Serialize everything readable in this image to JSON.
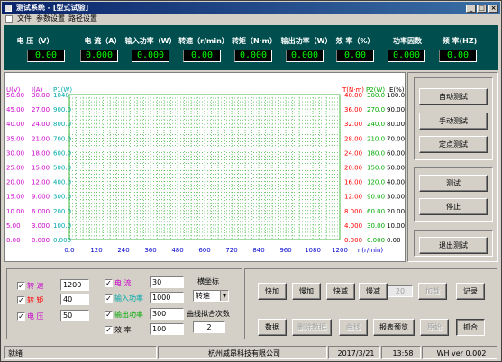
{
  "window": {
    "title": "测试系统 - [型式试验]"
  },
  "menu": {
    "items": [
      "文件",
      "参数设置",
      "路径设置"
    ]
  },
  "meters": [
    {
      "label": "电 压（V）",
      "value": "0.00"
    },
    {
      "label": "电 流（A）",
      "value": "0.000"
    },
    {
      "label": "输入功率（W）",
      "value": "0.000"
    },
    {
      "label": "转速（r/min）",
      "value": "0.00"
    },
    {
      "label": "转矩（N·m）",
      "value": "0.000"
    },
    {
      "label": "输出功率（W）",
      "value": "0.000"
    },
    {
      "label": "效 率（%）",
      "value": "0.00"
    },
    {
      "label": "功率因数",
      "value": "0.000"
    },
    {
      "label": "频 率(HZ)",
      "value": "0.00"
    }
  ],
  "chart": {
    "axis_headers": [
      "U(V)",
      "I(A)",
      "P1(W)",
      "T(N·m)",
      "P2(W)",
      "E(%)"
    ],
    "axis_colors": [
      "#cc00cc",
      "#cc00cc",
      "#00aaaa",
      "#ff0000",
      "#00aa00",
      "#000000"
    ],
    "left_u": [
      "50.00",
      "45.00",
      "40.00",
      "35.00",
      "30.00",
      "25.00",
      "20.00",
      "15.00",
      "10.00",
      "5.00",
      "0.00"
    ],
    "left_i": [
      "30.00",
      "27.00",
      "24.00",
      "21.00",
      "18.00",
      "15.00",
      "12.00",
      "9.000",
      "6.000",
      "3.000",
      "0.000"
    ],
    "left_p1": [
      "1040",
      "900.0",
      "800.0",
      "700.0",
      "600.0",
      "500.0",
      "400.0",
      "300.0",
      "200.0",
      "100.0",
      "0.000"
    ],
    "right_t": [
      "40.00",
      "36.00",
      "32.00",
      "28.00",
      "24.00",
      "20.00",
      "16.00",
      "12.00",
      "8.000",
      "4.000",
      "0.000"
    ],
    "right_p2": [
      "300.0",
      "270.0",
      "240.0",
      "210.0",
      "180.0",
      "150.0",
      "120.0",
      "90.00",
      "60.00",
      "30.00",
      "0.000"
    ],
    "right_e": [
      "100.00",
      "90.00",
      "80.00",
      "70.00",
      "60.00",
      "50.00",
      "40.00",
      "30.00",
      "20.00",
      "10.00",
      "0.00"
    ],
    "x_ticks": [
      "0.0",
      "120",
      "240",
      "360",
      "480",
      "600",
      "720",
      "840",
      "960",
      "1080",
      "1200"
    ],
    "x_unit": "n(r/min)"
  },
  "chart_data": {
    "type": "line",
    "xlabel": "n(r/min)",
    "xlim": [
      0,
      1200
    ],
    "grid": true,
    "series": [],
    "axes": [
      {
        "name": "U(V)",
        "ylim": [
          0,
          50
        ]
      },
      {
        "name": "I(A)",
        "ylim": [
          0,
          30
        ]
      },
      {
        "name": "P1(W)",
        "ylim": [
          0,
          1040
        ]
      },
      {
        "name": "T(N·m)",
        "ylim": [
          0,
          40
        ]
      },
      {
        "name": "P2(W)",
        "ylim": [
          0,
          300
        ]
      },
      {
        "name": "E(%)",
        "ylim": [
          0,
          100
        ]
      }
    ]
  },
  "test_buttons": {
    "auto": "自动测试",
    "manual": "手动测试",
    "fixed": "定点测试",
    "test": "测试",
    "stop": "停止",
    "exit": "退出测试"
  },
  "params": [
    {
      "label": "转 速",
      "value": "1200",
      "color": "#cc00cc",
      "checked": true
    },
    {
      "label": "转 矩",
      "value": "40",
      "color": "#ff0000",
      "checked": true
    },
    {
      "label": "电 压",
      "value": "50",
      "color": "#cc00cc",
      "checked": true
    },
    {
      "label": "电 流",
      "value": "30",
      "color": "#cc00cc",
      "checked": true
    },
    {
      "label": "输入功率",
      "value": "1000",
      "color": "#00aaaa",
      "checked": true
    },
    {
      "label": "输出功率",
      "value": "300",
      "color": "#00aa00",
      "checked": true
    },
    {
      "label": "效 率",
      "value": "100",
      "color": "#000000",
      "checked": true
    }
  ],
  "axis_select": {
    "title": "横坐标",
    "value": "转速"
  },
  "fit": {
    "title": "曲线拟合次数",
    "value": "2"
  },
  "control_buttons": {
    "fast_add": "快加",
    "slow_add": "慢加",
    "fast_sub": "快减",
    "slow_sub": "慢减",
    "step_value": "20",
    "load": "加载",
    "record": "记录"
  },
  "data_buttons": {
    "data": "数据",
    "delete": "删除数据",
    "curve": "曲线",
    "report": "报表预览",
    "origin": "原始",
    "capture": "抓合"
  },
  "status": {
    "state": "就绪",
    "company": "杭州威昂科技有限公司",
    "date": "2017/3/21",
    "time": "13:58",
    "version": "WH ver 0.002"
  }
}
